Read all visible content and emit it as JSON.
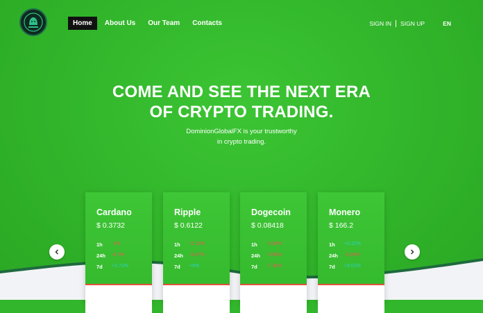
{
  "nav": {
    "items": [
      {
        "label": "Home",
        "active": true
      },
      {
        "label": "About Us"
      },
      {
        "label": "Our Team"
      },
      {
        "label": "Contacts"
      }
    ]
  },
  "auth": {
    "sign_in": "SIGN IN",
    "sign_up": "SIGN UP"
  },
  "language": "EN",
  "hero": {
    "headline_line1": "COME AND SEE THE NEXT ERA",
    "headline_line2": "OF CRYPTO TRADING.",
    "sub_line1": "DominionGlobalFX is your trustworthy",
    "sub_line2": "in crypto trading."
  },
  "cards": [
    {
      "name": "Cardano",
      "price": "$ 0.3732",
      "rows": [
        {
          "label": "1h",
          "value": "-1%",
          "dir": "neg"
        },
        {
          "label": "24h",
          "value": "-8.7%",
          "dir": "neg"
        },
        {
          "label": "7d",
          "value": "+2.72%",
          "dir": "pos"
        }
      ]
    },
    {
      "name": "Ripple",
      "price": "$ 0.6122",
      "rows": [
        {
          "label": "1h",
          "value": "-0.13%",
          "dir": "neg"
        },
        {
          "label": "24h",
          "value": "-0.07%",
          "dir": "neg"
        },
        {
          "label": "7d",
          "value": "+6%",
          "dir": "pos"
        }
      ]
    },
    {
      "name": "Dogecoin",
      "price": "$ 0.08418",
      "rows": [
        {
          "label": "1h",
          "value": "-0.08%",
          "dir": "neg"
        },
        {
          "label": "24h",
          "value": "-0.56%",
          "dir": "neg"
        },
        {
          "label": "7d",
          "value": "-7.36%",
          "dir": "neg"
        }
      ]
    },
    {
      "name": "Monero",
      "price": "$ 166.2",
      "rows": [
        {
          "label": "1h",
          "value": "+0.22%",
          "dir": "pos"
        },
        {
          "label": "24h",
          "value": "-0.29%",
          "dir": "neg"
        },
        {
          "label": "7d",
          "value": "+5.01%",
          "dir": "pos"
        }
      ]
    }
  ],
  "colors": {
    "brand_green": "#32b62b",
    "negative": "#e85a52",
    "positive": "#2fd0c6",
    "nav_active": "#111111"
  },
  "icons": {
    "logo": "lion-emblem-icon",
    "prev": "chevron-left-icon",
    "next": "chevron-right-icon"
  }
}
